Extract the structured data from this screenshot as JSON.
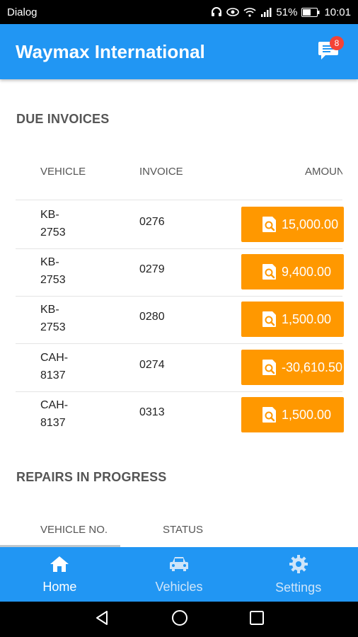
{
  "status_bar": {
    "carrier": "Dialog",
    "battery": "51%",
    "time": "10:01",
    "icons": [
      "headphones-icon",
      "eye-icon",
      "wifi-icon",
      "signal-icon",
      "battery-icon"
    ]
  },
  "app_bar": {
    "title": "Waymax International",
    "messages_icon": "chat-bubble-icon",
    "messages_badge": "8"
  },
  "due_invoices": {
    "title": "DUE INVOICES",
    "columns": [
      "VEHICLE",
      "INVOICE",
      "AMOUNT"
    ],
    "rows": [
      {
        "vehicle_line1": "KB-",
        "vehicle_line2": "2753",
        "invoice": "0276",
        "amount": "15,000.00"
      },
      {
        "vehicle_line1": "KB-",
        "vehicle_line2": "2753",
        "invoice": "0279",
        "amount": "9,400.00"
      },
      {
        "vehicle_line1": "KB-",
        "vehicle_line2": "2753",
        "invoice": "0280",
        "amount": "1,500.00"
      },
      {
        "vehicle_line1": "CAH-",
        "vehicle_line2": "8137",
        "invoice": "0274",
        "amount": "-30,610.50"
      },
      {
        "vehicle_line1": "CAH-",
        "vehicle_line2": "8137",
        "invoice": "0313",
        "amount": "1,500.00"
      }
    ]
  },
  "repairs": {
    "title": "REPAIRS IN PROGRESS",
    "columns": [
      "VEHICLE NO.",
      "STATUS"
    ]
  },
  "bottom_nav": [
    {
      "label": "Home",
      "icon": "home-icon",
      "active": true
    },
    {
      "label": "Vehicles",
      "icon": "car-icon",
      "active": false
    },
    {
      "label": "Settings",
      "icon": "gear-icon",
      "active": false
    }
  ],
  "colors": {
    "primary": "#2196F3",
    "accent": "#FF9800",
    "badge": "#F44336"
  }
}
